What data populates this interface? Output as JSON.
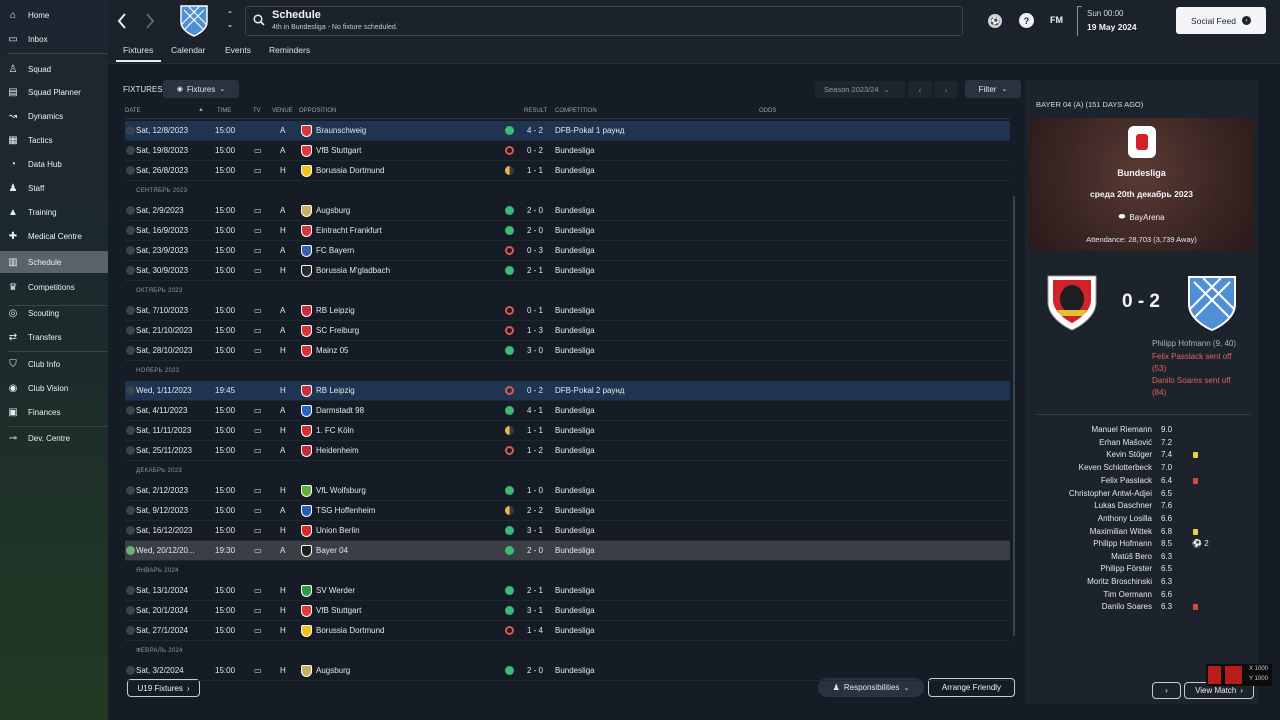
{
  "sidebar": {
    "items": [
      {
        "label": "Home",
        "icon": "home-icon",
        "glyph": "⌂"
      },
      {
        "label": "Inbox",
        "icon": "inbox-icon",
        "glyph": "▭"
      },
      {
        "label": "Squad",
        "icon": "shirt-icon",
        "glyph": "♙"
      },
      {
        "label": "Squad Planner",
        "icon": "planner-icon",
        "glyph": "▤"
      },
      {
        "label": "Dynamics",
        "icon": "dynamics-icon",
        "glyph": "↝"
      },
      {
        "label": "Tactics",
        "icon": "tactics-icon",
        "glyph": "▦"
      },
      {
        "label": "Data Hub",
        "icon": "data-hub-icon",
        "glyph": "◔"
      },
      {
        "label": "Staff",
        "icon": "staff-icon",
        "glyph": "♟"
      },
      {
        "label": "Training",
        "icon": "training-icon",
        "glyph": "▲"
      },
      {
        "label": "Medical Centre",
        "icon": "medical-icon",
        "glyph": "✚"
      },
      {
        "label": "Schedule",
        "icon": "calendar-icon",
        "glyph": "▥"
      },
      {
        "label": "Competitions",
        "icon": "trophy-icon",
        "glyph": "♛"
      },
      {
        "label": "Scouting",
        "icon": "scouting-icon",
        "glyph": "◎"
      },
      {
        "label": "Transfers",
        "icon": "transfers-icon",
        "glyph": "⇄"
      },
      {
        "label": "Club Info",
        "icon": "shield-icon",
        "glyph": "⛉"
      },
      {
        "label": "Club Vision",
        "icon": "vision-icon",
        "glyph": "◉"
      },
      {
        "label": "Finances",
        "icon": "finances-icon",
        "glyph": "▣"
      },
      {
        "label": "Dev. Centre",
        "icon": "dev-centre-icon",
        "glyph": "⊸"
      }
    ]
  },
  "topbar": {
    "title": "Schedule",
    "subtitle": "4th in Bundesliga - No fixture scheduled.",
    "fm_label": "FM",
    "help_glyph": "?",
    "time": "Sun 00:00",
    "date": "19 May 2024",
    "social_feed": "Social Feed"
  },
  "tabs": [
    "Fixtures",
    "Calendar",
    "Events",
    "Reminders"
  ],
  "fixtures": {
    "section_label": "FIXTURES",
    "view_dropdown": "Fixtures",
    "season": "Season 2023/24",
    "filter": "Filter",
    "headers": [
      "DATE",
      "TIME",
      "TV",
      "VENUE",
      "OPPOSITION",
      "RESULT",
      "COMPETITION",
      "ODDS"
    ],
    "rows": [
      {
        "type": "match",
        "date": "Sat, 12/8/2023",
        "time": "15:00",
        "tv": false,
        "venue": "A",
        "opp": "Braunschweig",
        "crest": "#d33a3a",
        "res": "w",
        "score": "4 - 2",
        "comp": "DFB-Pokal 1 раунд",
        "hl": true
      },
      {
        "type": "match",
        "date": "Sat, 19/8/2023",
        "time": "15:00",
        "tv": true,
        "venue": "A",
        "opp": "VfB Stuttgart",
        "crest": "#e03a3a",
        "res": "l",
        "score": "0 - 2",
        "comp": "Bundesliga"
      },
      {
        "type": "match",
        "date": "Sat, 26/8/2023",
        "time": "15:00",
        "tv": true,
        "venue": "H",
        "opp": "Borussia Dortmund",
        "crest": "#f2c21a",
        "res": "d",
        "score": "1 - 1",
        "comp": "Bundesliga"
      },
      {
        "type": "month",
        "label": "СЕНТЯБРЬ 2023"
      },
      {
        "type": "match",
        "date": "Sat, 2/9/2023",
        "time": "15:00",
        "tv": true,
        "venue": "A",
        "opp": "Augsburg",
        "crest": "#c8b15a",
        "res": "w",
        "score": "2 - 0",
        "comp": "Bundesliga"
      },
      {
        "type": "match",
        "date": "Sat, 16/9/2023",
        "time": "15:00",
        "tv": true,
        "venue": "H",
        "opp": "Eintracht Frankfurt",
        "crest": "#d23a3a",
        "res": "w",
        "score": "2 - 0",
        "comp": "Bundesliga"
      },
      {
        "type": "match",
        "date": "Sat, 23/9/2023",
        "time": "15:00",
        "tv": true,
        "venue": "A",
        "opp": "FC Bayern",
        "crest": "#3a5fb0",
        "res": "l",
        "score": "0 - 3",
        "comp": "Bundesliga"
      },
      {
        "type": "match",
        "date": "Sat, 30/9/2023",
        "time": "15:00",
        "tv": true,
        "venue": "H",
        "opp": "Borussia M'gladbach",
        "crest": "#2a2a2a",
        "res": "w",
        "score": "2 - 1",
        "comp": "Bundesliga"
      },
      {
        "type": "month",
        "label": "ОКТЯБРЬ 2023"
      },
      {
        "type": "match",
        "date": "Sat, 7/10/2023",
        "time": "15:00",
        "tv": true,
        "venue": "A",
        "opp": "RB Leipzig",
        "crest": "#c9303c",
        "res": "l",
        "score": "0 - 1",
        "comp": "Bundesliga"
      },
      {
        "type": "match",
        "date": "Sat, 21/10/2023",
        "time": "15:00",
        "tv": true,
        "venue": "A",
        "opp": "SC Freiburg",
        "crest": "#d63838",
        "res": "l",
        "score": "1 - 3",
        "comp": "Bundesliga"
      },
      {
        "type": "match",
        "date": "Sat, 28/10/2023",
        "time": "15:00",
        "tv": true,
        "venue": "H",
        "opp": "Mainz 05",
        "crest": "#d8323a",
        "res": "w",
        "score": "3 - 0",
        "comp": "Bundesliga"
      },
      {
        "type": "month",
        "label": "НОЯБРЬ 2023"
      },
      {
        "type": "match",
        "date": "Wed, 1/11/2023",
        "time": "19:45",
        "tv": false,
        "venue": "H",
        "opp": "RB Leipzig",
        "crest": "#c9303c",
        "res": "l",
        "score": "0 - 2",
        "comp": "DFB-Pokal 2 раунд",
        "hl": true
      },
      {
        "type": "match",
        "date": "Sat, 4/11/2023",
        "time": "15:00",
        "tv": true,
        "venue": "A",
        "opp": "Darmstadt 98",
        "crest": "#2a62c0",
        "res": "w",
        "score": "4 - 1",
        "comp": "Bundesliga"
      },
      {
        "type": "match",
        "date": "Sat, 11/11/2023",
        "time": "15:00",
        "tv": true,
        "venue": "H",
        "opp": "1. FC Köln",
        "crest": "#d43030",
        "res": "d",
        "score": "1 - 1",
        "comp": "Bundesliga"
      },
      {
        "type": "match",
        "date": "Sat, 25/11/2023",
        "time": "15:00",
        "tv": true,
        "venue": "A",
        "opp": "Heidenheim",
        "crest": "#c22a3a",
        "res": "l",
        "score": "1 - 2",
        "comp": "Bundesliga"
      },
      {
        "type": "month",
        "label": "ДЕКАБРЬ 2023"
      },
      {
        "type": "match",
        "date": "Sat, 2/12/2023",
        "time": "15:00",
        "tv": true,
        "venue": "H",
        "opp": "VfL Wolfsburg",
        "crest": "#5fae3a",
        "res": "w",
        "score": "1 - 0",
        "comp": "Bundesliga"
      },
      {
        "type": "match",
        "date": "Sat, 9/12/2023",
        "time": "15:00",
        "tv": true,
        "venue": "A",
        "opp": "TSG Hoffenheim",
        "crest": "#2a5fb8",
        "res": "d",
        "score": "2 - 2",
        "comp": "Bundesliga"
      },
      {
        "type": "match",
        "date": "Sat, 16/12/2023",
        "time": "15:00",
        "tv": true,
        "venue": "H",
        "opp": "Union Berlin",
        "crest": "#d62a2a",
        "res": "w",
        "score": "3 - 1",
        "comp": "Bundesliga"
      },
      {
        "type": "match",
        "date": "Wed, 20/12/20...",
        "time": "19:30",
        "tv": true,
        "venue": "A",
        "opp": "Bayer 04",
        "crest": "#1e1e1e",
        "res": "w",
        "score": "2 - 0",
        "comp": "Bundesliga",
        "sel": true
      },
      {
        "type": "month",
        "label": "ЯНВАРЬ 2024"
      },
      {
        "type": "match",
        "date": "Sat, 13/1/2024",
        "time": "15:00",
        "tv": true,
        "venue": "H",
        "opp": "SV Werder",
        "crest": "#2e9a4a",
        "res": "w",
        "score": "2 - 1",
        "comp": "Bundesliga"
      },
      {
        "type": "match",
        "date": "Sat, 20/1/2024",
        "time": "15:00",
        "tv": true,
        "venue": "H",
        "opp": "VfB Stuttgart",
        "crest": "#e03a3a",
        "res": "w",
        "score": "3 - 1",
        "comp": "Bundesliga"
      },
      {
        "type": "match",
        "date": "Sat, 27/1/2024",
        "time": "15:00",
        "tv": true,
        "venue": "H",
        "opp": "Borussia Dortmund",
        "crest": "#f2c21a",
        "res": "l",
        "score": "1 - 4",
        "comp": "Bundesliga"
      },
      {
        "type": "month",
        "label": "ФЕВРАЛЬ 2024"
      },
      {
        "type": "match",
        "date": "Sat, 3/2/2024",
        "time": "15:00",
        "tv": true,
        "venue": "H",
        "opp": "Augsburg",
        "crest": "#c8b15a",
        "res": "w",
        "score": "2 - 0",
        "comp": "Bundesliga"
      }
    ],
    "u19_button": "U19 Fixtures",
    "responsibilities": "Responsibilities",
    "arrange_friendly": "Arrange Friendly"
  },
  "match_panel": {
    "header": "BAYER 04 (A) (151 DAYS AGO)",
    "competition": "Bundesliga",
    "date": "среда 20th декабрь 2023",
    "stadium": "BayArena",
    "attendance": "Attendance: 28,703 (3,739 Away)",
    "score": "0 - 2",
    "events": [
      "Philipp Hofmann (9, 40)",
      "Felix Passlack sent off (53)",
      "Danilo Soares sent off (84)"
    ],
    "players": [
      {
        "name": "Manuel Riemann",
        "rating": "9.0"
      },
      {
        "name": "Erhan Mašović",
        "rating": "7.2"
      },
      {
        "name": "Kevin Stöger",
        "rating": "7.4",
        "card": "yellow"
      },
      {
        "name": "Keven Schlotterbeck",
        "rating": "7.0"
      },
      {
        "name": "Felix Passlack",
        "rating": "6.4",
        "card": "red"
      },
      {
        "name": "Christopher Antwi-Adjei",
        "rating": "6.5"
      },
      {
        "name": "Lukas Daschner",
        "rating": "7.6"
      },
      {
        "name": "Anthony Losilla",
        "rating": "6.6"
      },
      {
        "name": "Maximilian Wittek",
        "rating": "6.8",
        "card": "yellow"
      },
      {
        "name": "Philipp Hofmann",
        "rating": "8.5",
        "goals": "2"
      },
      {
        "name": "Matúš Bero",
        "rating": "6.3"
      },
      {
        "name": "Philipp Förster",
        "rating": "6.5"
      },
      {
        "name": "Moritz Broschinski",
        "rating": "6.3"
      },
      {
        "name": "Tim Oermann",
        "rating": "6.6"
      },
      {
        "name": "Danilo Soares",
        "rating": "6.3",
        "card": "red"
      }
    ],
    "view_match": "View Match"
  },
  "corner_overlay": {
    "x": "X 1000",
    "y": "Y 1000"
  }
}
